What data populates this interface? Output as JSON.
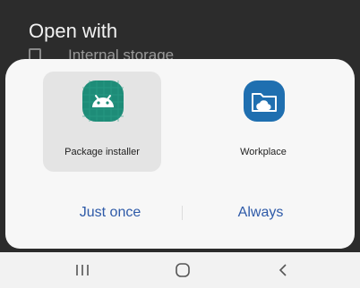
{
  "dialog": {
    "title": "Open with",
    "background_item": "Internal storage"
  },
  "apps": [
    {
      "label": "Package installer",
      "icon": "android-icon",
      "color": "#1e8c78",
      "selected": true
    },
    {
      "label": "Workplace",
      "icon": "folder-cloud-icon",
      "color": "#1f6fb0",
      "selected": false
    }
  ],
  "actions": {
    "just_once": "Just once",
    "always": "Always"
  },
  "navbar": {
    "recents": "recents-icon",
    "home": "home-icon",
    "back": "back-icon"
  },
  "colors": {
    "accent": "#2e5aa8",
    "selected_tile": "#e4e4e4"
  }
}
